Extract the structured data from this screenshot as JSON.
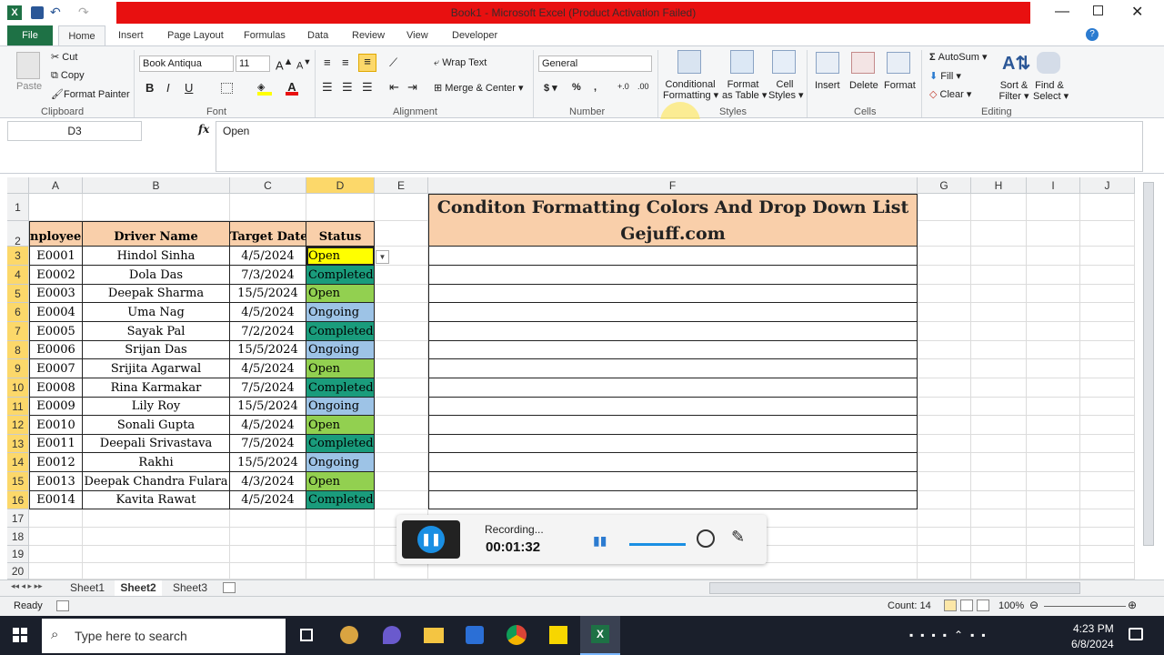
{
  "window": {
    "title": "Book1 - Microsoft Excel (Product Activation Failed)"
  },
  "tabs": [
    "File",
    "Home",
    "Insert",
    "Page Layout",
    "Formulas",
    "Data",
    "Review",
    "View",
    "Developer"
  ],
  "clipboard": {
    "paste": "Paste",
    "cut": "Cut",
    "copy": "Copy",
    "format_painter": "Format Painter",
    "label": "Clipboard"
  },
  "font": {
    "name": "Book Antiqua",
    "size": "11",
    "label": "Font"
  },
  "alignment": {
    "wrap": "Wrap Text",
    "merge": "Merge & Center",
    "label": "Alignment"
  },
  "number": {
    "format": "General",
    "label": "Number"
  },
  "styles": {
    "conditional": "Conditional",
    "conditional2": "Formatting",
    "format_table": "Format",
    "format_table2": "as Table",
    "cell_styles": "Cell",
    "cell_styles2": "Styles",
    "label": "Styles"
  },
  "cells": {
    "insert": "Insert",
    "delete": "Delete",
    "format": "Format",
    "label": "Cells"
  },
  "editing": {
    "autosum": "AutoSum",
    "fill": "Fill",
    "clear": "Clear",
    "sort": "Sort &",
    "sort2": "Filter",
    "find": "Find &",
    "find2": "Select",
    "label": "Editing"
  },
  "formula_bar": {
    "name_box": "D3",
    "fx": "fx",
    "value": "Open"
  },
  "columns": [
    "A",
    "B",
    "C",
    "D",
    "E",
    "F",
    "G",
    "H",
    "I",
    "J"
  ],
  "rows": [
    "1",
    "2",
    "3",
    "4",
    "5",
    "6",
    "7",
    "8",
    "9",
    "10",
    "11",
    "12",
    "13",
    "14",
    "15",
    "16",
    "17",
    "18",
    "19",
    "20"
  ],
  "table": {
    "headers": [
      "nployee I",
      "Driver Name",
      "Target Date",
      "Status"
    ],
    "rows": [
      [
        "E0001",
        "Hindol Sinha",
        "4/5/2024",
        "Open"
      ],
      [
        "E0002",
        "Dola Das",
        "7/3/2024",
        "Completed"
      ],
      [
        "E0003",
        "Deepak Sharma",
        "15/5/2024",
        "Open"
      ],
      [
        "E0004",
        "Uma Nag",
        "4/5/2024",
        "Ongoing"
      ],
      [
        "E0005",
        "Sayak Pal",
        "7/2/2024",
        "Completed"
      ],
      [
        "E0006",
        "Srijan Das",
        "15/5/2024",
        "Ongoing"
      ],
      [
        "E0007",
        "Srijita Agarwal",
        "4/5/2024",
        "Open"
      ],
      [
        "E0008",
        "Rina Karmakar",
        "7/5/2024",
        "Completed"
      ],
      [
        "E0009",
        "Lily Roy",
        "15/5/2024",
        "Ongoing"
      ],
      [
        "E0010",
        "Sonali Gupta",
        "4/5/2024",
        "Open"
      ],
      [
        "E0011",
        "Deepali Srivastava",
        "7/5/2024",
        "Completed"
      ],
      [
        "E0012",
        "Rakhi",
        "15/5/2024",
        "Ongoing"
      ],
      [
        "E0013",
        "Deepak Chandra Fulara",
        "4/3/2024",
        "Open"
      ],
      [
        "E0014",
        "Kavita Rawat",
        "4/5/2024",
        "Completed"
      ]
    ]
  },
  "banner": {
    "line1": "Conditon Formatting Colors And Drop Down List",
    "line2": "Gejuff.com"
  },
  "status_colors": {
    "Open": "#92d050",
    "Open_selected": "#ffff00",
    "Completed": "#1a9c7c",
    "Ongoing": "#9dc3e6"
  },
  "sheets": [
    "Sheet1",
    "Sheet2",
    "Sheet3"
  ],
  "statusbar": {
    "ready": "Ready",
    "count": "Count: 14",
    "zoom": "100%"
  },
  "recorder": {
    "label": "Recording...",
    "time": "00:01:32"
  },
  "taskbar": {
    "search": "Type here to search",
    "time": "4:23 PM",
    "date": "6/8/2024"
  }
}
